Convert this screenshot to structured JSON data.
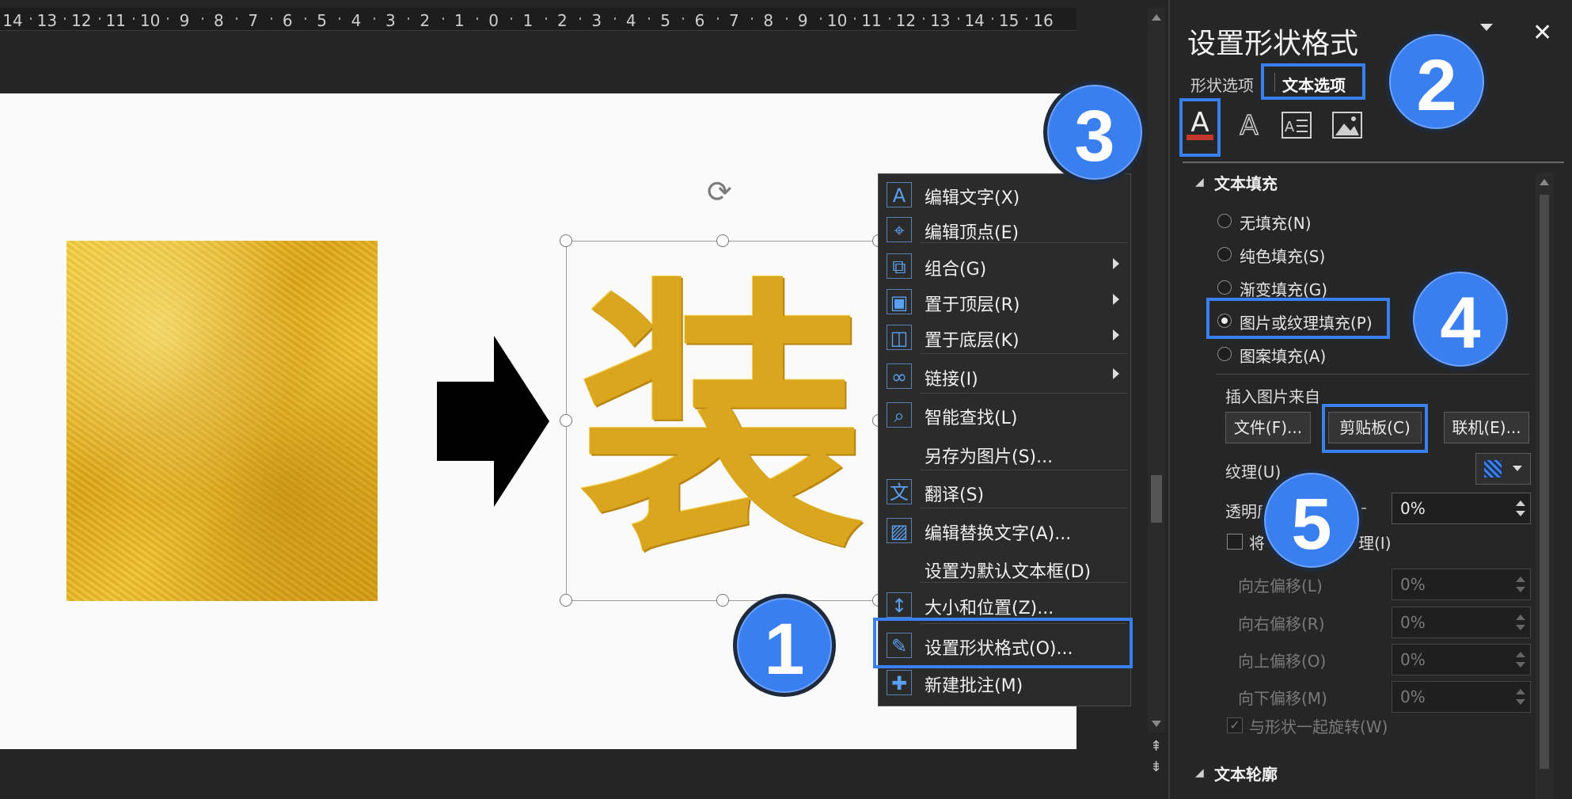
{
  "ruler": {
    "ticks": [
      "14",
      "13",
      "12",
      "11",
      "10",
      "9",
      "8",
      "7",
      "6",
      "5",
      "4",
      "3",
      "2",
      "1",
      "0",
      "1",
      "2",
      "3",
      "4",
      "5",
      "6",
      "7",
      "8",
      "9",
      "10",
      "11",
      "12",
      "13",
      "14",
      "15",
      "16"
    ]
  },
  "slide": {
    "character": "装"
  },
  "context_menu": {
    "items": [
      {
        "label": "编辑文字(X)",
        "icon": "edit-text-icon",
        "submenu": false
      },
      {
        "label": "编辑顶点(E)",
        "icon": "edit-points-icon",
        "submenu": false
      },
      {
        "label": "组合(G)",
        "icon": "group-icon",
        "submenu": true
      },
      {
        "label": "置于顶层(R)",
        "icon": "bring-to-front-icon",
        "submenu": true
      },
      {
        "label": "置于底层(K)",
        "icon": "send-to-back-icon",
        "submenu": true
      },
      {
        "label": "链接(I)",
        "icon": "link-icon",
        "submenu": true
      },
      {
        "label": "智能查找(L)",
        "icon": "smart-lookup-icon",
        "submenu": false
      },
      {
        "label": "另存为图片(S)...",
        "icon": "",
        "submenu": false
      },
      {
        "label": "翻译(S)",
        "icon": "translate-icon",
        "submenu": false
      },
      {
        "label": "编辑替换文字(A)...",
        "icon": "alt-text-icon",
        "submenu": false
      },
      {
        "label": "设置为默认文本框(D)",
        "icon": "",
        "submenu": false
      },
      {
        "label": "大小和位置(Z)...",
        "icon": "size-position-icon",
        "submenu": false
      },
      {
        "label": "设置形状格式(O)...",
        "icon": "format-shape-icon",
        "submenu": false
      },
      {
        "label": "新建批注(M)",
        "icon": "new-comment-icon",
        "submenu": false
      }
    ]
  },
  "pane": {
    "title": "设置形状格式",
    "tabs": [
      "形状选项",
      "文本选项"
    ],
    "section_fill": "文本填充",
    "fill_options": [
      {
        "label": "无填充(N)",
        "selected": false
      },
      {
        "label": "纯色填充(S)",
        "selected": false
      },
      {
        "label": "渐变填充(G)",
        "selected": false
      },
      {
        "label": "图片或纹理填充(P)",
        "selected": true
      },
      {
        "label": "图案填充(A)",
        "selected": false
      }
    ],
    "insert_from_label": "插入图片来自",
    "buttons": {
      "file": "文件(F)...",
      "clipboard": "剪贴板(C)",
      "online": "联机(E)..."
    },
    "texture_label": "纹理(U)",
    "transparency_label": "透明度",
    "transparency_value": "0%",
    "tile_label_prefix": "将",
    "tile_label_suffix": "理(I)",
    "offsets": [
      {
        "label": "向左偏移(L)",
        "value": "0%"
      },
      {
        "label": "向右偏移(R)",
        "value": "0%"
      },
      {
        "label": "向上偏移(O)",
        "value": "0%"
      },
      {
        "label": "向下偏移(M)",
        "value": "0%"
      }
    ],
    "rotate_with_shape": "与形状一起旋转(W)",
    "section_outline": "文本轮廓"
  },
  "callouts": [
    "1",
    "2",
    "3",
    "4",
    "5"
  ],
  "colors": {
    "accent": "#3a7ff0",
    "gold": "#d9a61e",
    "fill_red": "#c0392b"
  }
}
